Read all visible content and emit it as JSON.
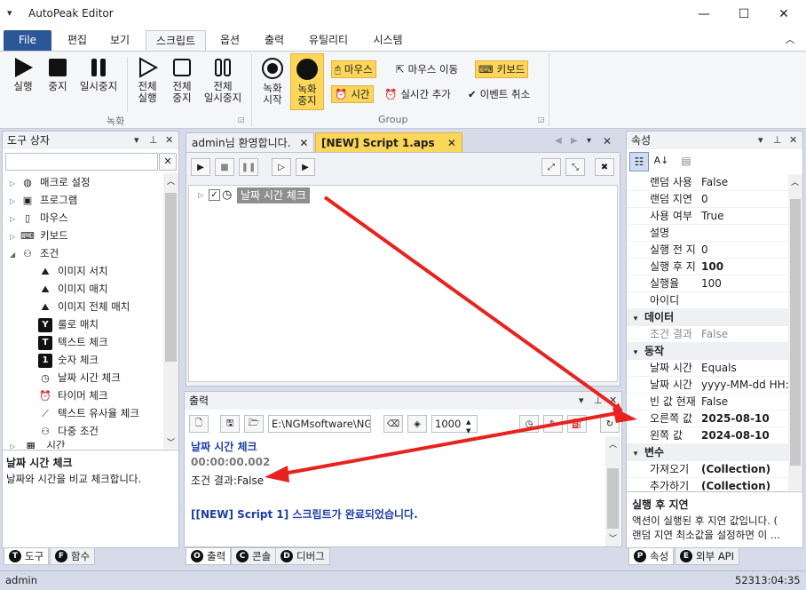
{
  "window": {
    "title": "AutoPeak Editor",
    "system_menu": "▾",
    "minimize": "—",
    "maximize": "☐",
    "close": "✕"
  },
  "ribbon_tabs": [
    "File",
    "편집",
    "보기",
    "스크립트",
    "옵션",
    "출력",
    "유틸리티",
    "시스템"
  ],
  "ribbon_collapse": "︿",
  "ribbon": {
    "run": "실행",
    "stop": "중지",
    "pause": "일시중지",
    "run_all_1": "전체",
    "run_all_2": "실행",
    "stop_all_1": "전체",
    "stop_all_2": "중지",
    "pause_all_1": "전체",
    "pause_all_2": "일시중지",
    "rec_start_1": "녹화",
    "rec_start_2": "시작",
    "rec_stop_1": "녹화",
    "rec_stop_2": "중지",
    "mouse": "마우스",
    "mouse_move": "마우스 이동",
    "keyboard": "키보드",
    "time": "시간",
    "realtime_add": "실시간 추가",
    "event_cancel": "이벤트 취소",
    "group_record": "녹화",
    "group_group": "Group"
  },
  "toolbox": {
    "title": "도구 상자",
    "items": [
      {
        "label": "매크로 설정",
        "icon": "globe-icon",
        "glyph": "◍"
      },
      {
        "label": "프로그램",
        "icon": "program-icon",
        "glyph": "▣"
      },
      {
        "label": "마우스",
        "icon": "mouse-icon",
        "glyph": "▯"
      },
      {
        "label": "키보드",
        "icon": "keyboard-icon",
        "glyph": "⌨"
      },
      {
        "label": "조건",
        "icon": "condition-icon",
        "glyph": "⚇"
      }
    ],
    "children": [
      {
        "label": "이미지 서치",
        "icon": "image-search-icon",
        "glyph": "⛰"
      },
      {
        "label": "이미지 매치",
        "icon": "image-match-icon",
        "glyph": "⛰"
      },
      {
        "label": "이미지 전체 매치",
        "icon": "image-all-match-icon",
        "glyph": "⛰"
      },
      {
        "label": "룰로 매치",
        "icon": "rule-match-icon",
        "glyph": "Y"
      },
      {
        "label": "텍스트 체크",
        "icon": "text-check-icon",
        "glyph": "T"
      },
      {
        "label": "숫자 체크",
        "icon": "number-check-icon",
        "glyph": "1"
      },
      {
        "label": "날짜 시간 체크",
        "icon": "datetime-check-icon",
        "glyph": "◷"
      },
      {
        "label": "타이머 체크",
        "icon": "timer-check-icon",
        "glyph": "⏰"
      },
      {
        "label": "텍스트 유사율 체크",
        "icon": "text-similarity-icon",
        "glyph": "⟋"
      },
      {
        "label": "다중 조건",
        "icon": "multi-condition-icon",
        "glyph": "⚇"
      }
    ],
    "cut_item": "시간",
    "desc_title": "날짜 시간 체크",
    "desc_text": "날짜와 시간을 비교 체크합니다.",
    "tab_tools": "도구",
    "tab_funcs": "함수"
  },
  "editor": {
    "tab_welcome": "admin님 환영합니다.",
    "tab_script": "[NEW] Script 1.aps",
    "tree_node": "날짜 시간 체크"
  },
  "output": {
    "title": "출력",
    "path": "E:\\NGMsoftware\\NG",
    "number": "1000",
    "lines": {
      "l1": "날짜 시간 체크",
      "l2": "00:00:00.002",
      "l3": "조건 결과:False",
      "l4": "[[NEW] Script 1] 스크립트가 완료되었습니다."
    },
    "tab_output": "출력",
    "tab_console": "콘솔",
    "tab_debug": "디버그"
  },
  "properties": {
    "title": "속성",
    "rows": [
      {
        "k": "랜덤 사용",
        "v": "False",
        "bold": false
      },
      {
        "k": "랜덤 지연",
        "v": "0",
        "bold": false
      },
      {
        "k": "사용 여부",
        "v": "True",
        "bold": false
      },
      {
        "k": "설명",
        "v": "",
        "bold": false
      },
      {
        "k": "실행 전 지",
        "v": "0",
        "bold": false
      },
      {
        "k": "실행 후 지",
        "v": "100",
        "bold": true
      },
      {
        "k": "실행율",
        "v": "100",
        "bold": false
      },
      {
        "k": "아이디",
        "v": "",
        "bold": false
      }
    ],
    "cat_data": "데이터",
    "data_rows": [
      {
        "k": "조건 결과",
        "v": "False",
        "bold": false
      }
    ],
    "cat_action": "동작",
    "action_rows": [
      {
        "k": "날짜 시간",
        "v": "Equals",
        "bold": false
      },
      {
        "k": "날짜 시간",
        "v": "yyyy-MM-dd HH:",
        "bold": false
      },
      {
        "k": "빈 값 현재",
        "v": "False",
        "bold": false
      },
      {
        "k": "오른쪽 값",
        "v": "2025-08-10",
        "bold": true
      },
      {
        "k": "왼쪽 값",
        "v": "2024-08-10",
        "bold": true
      }
    ],
    "cat_vars": "변수",
    "var_rows": [
      {
        "k": "가져오기",
        "v": "(Collection)",
        "bold": true
      },
      {
        "k": "추가하기",
        "v": "(Collection)",
        "bold": true
      }
    ],
    "desc_title": "실행 후 지연",
    "desc_text_1": "액션이 실행된 후 지연 값입니다. (",
    "desc_text_2": "랜덤 지연 최소값을 설정하면 이 ...",
    "tab_props": "속성",
    "tab_api": "외부 API"
  },
  "status": {
    "user": "admin",
    "clock": "52313:04:35"
  },
  "colors": {
    "accent": "#2b5797",
    "highlight": "#fbd65a",
    "arrow": "#e8231f",
    "link_blue": "#1e3fa8"
  }
}
